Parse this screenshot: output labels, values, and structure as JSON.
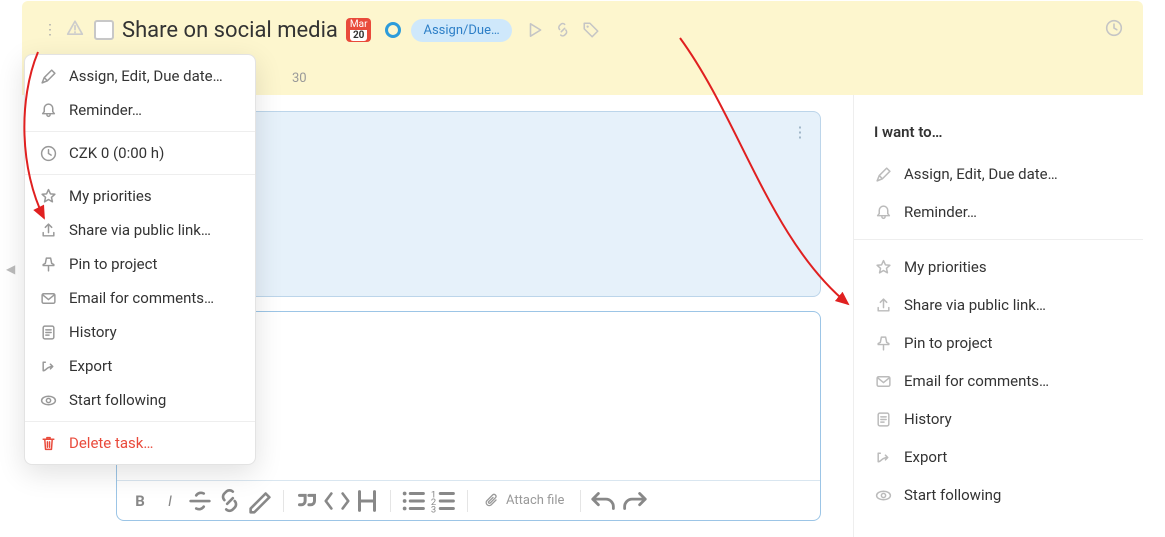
{
  "header": {
    "task_title": "Share on social media",
    "date_badge_month": "Mar",
    "date_badge_day": "20",
    "assign_pill": "Assign/Due…",
    "sub_text": "30"
  },
  "context_menu": {
    "items": [
      {
        "label": "Assign, Edit, Due date…",
        "icon": "pencil"
      },
      {
        "label": "Reminder…",
        "icon": "bell"
      }
    ],
    "cost_label": "CZK 0 (0:00 h)",
    "items2": [
      {
        "label": "My priorities",
        "icon": "star"
      },
      {
        "label": "Share via public link…",
        "icon": "share"
      },
      {
        "label": "Pin to project",
        "icon": "pin"
      },
      {
        "label": "Email for comments…",
        "icon": "mail"
      },
      {
        "label": "History",
        "icon": "history-doc"
      },
      {
        "label": "Export",
        "icon": "export-arrow"
      },
      {
        "label": "Start following",
        "icon": "eye"
      }
    ],
    "delete_label": "Delete task…"
  },
  "sidebar": {
    "title": "I want to…",
    "items": [
      {
        "label": "Assign, Edit, Due date…",
        "icon": "pencil"
      },
      {
        "label": "Reminder…",
        "icon": "bell"
      }
    ],
    "items2": [
      {
        "label": "My priorities",
        "icon": "star"
      },
      {
        "label": "Share via public link…",
        "icon": "share"
      },
      {
        "label": "Pin to project",
        "icon": "pin"
      },
      {
        "label": "Email for comments…",
        "icon": "mail"
      },
      {
        "label": "History",
        "icon": "history-doc"
      },
      {
        "label": "Export",
        "icon": "export-arrow"
      },
      {
        "label": "Start following",
        "icon": "eye"
      }
    ]
  },
  "editor": {
    "attach_label": "Attach file"
  }
}
